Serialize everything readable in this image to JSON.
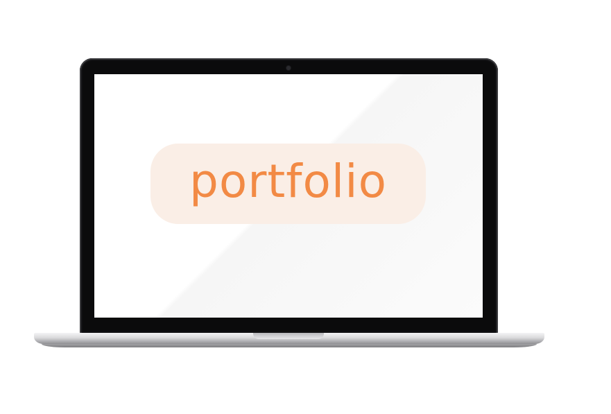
{
  "logo": {
    "text": "portfolio"
  },
  "colors": {
    "logo_text": "#f28a45",
    "logo_background": "#faeee6",
    "bezel": "#0b0b0c",
    "screen": "#ffffff"
  }
}
